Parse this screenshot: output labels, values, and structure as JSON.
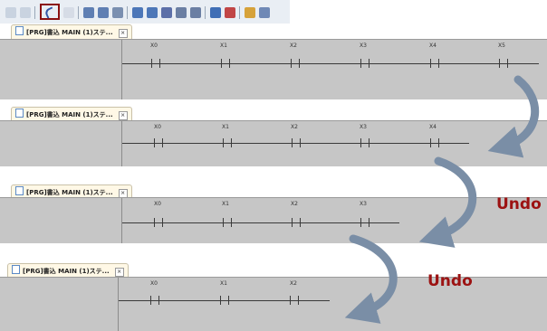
{
  "toolbar": {
    "undo_button_label": "Undo",
    "icons": [
      "cut-icon",
      "copy-icon",
      "undo-icon",
      "redo-icon",
      "ladder-contact-icon",
      "ladder-coil-icon",
      "ladder-line-icon",
      "ladder-search-icon",
      "view-icon",
      "zoom-icon"
    ]
  },
  "tab_title": "[PRG]書込 MAIN (1)ステ...",
  "tab_close": "×",
  "panels": [
    {
      "contacts": [
        "X0",
        "X1",
        "X2",
        "X3",
        "X4",
        "X5"
      ]
    },
    {
      "contacts": [
        "X0",
        "X1",
        "X2",
        "X3",
        "X4"
      ]
    },
    {
      "contacts": [
        "X0",
        "X1",
        "X2",
        "X3"
      ]
    },
    {
      "contacts": [
        "X0",
        "X1",
        "X2"
      ]
    }
  ],
  "labels": {
    "undo_1": "Undo",
    "undo_2": "Undo"
  },
  "colors": {
    "undo_text": "#9c1212",
    "arrow": "#7a8ea6",
    "highlight_box": "#8a1010"
  }
}
